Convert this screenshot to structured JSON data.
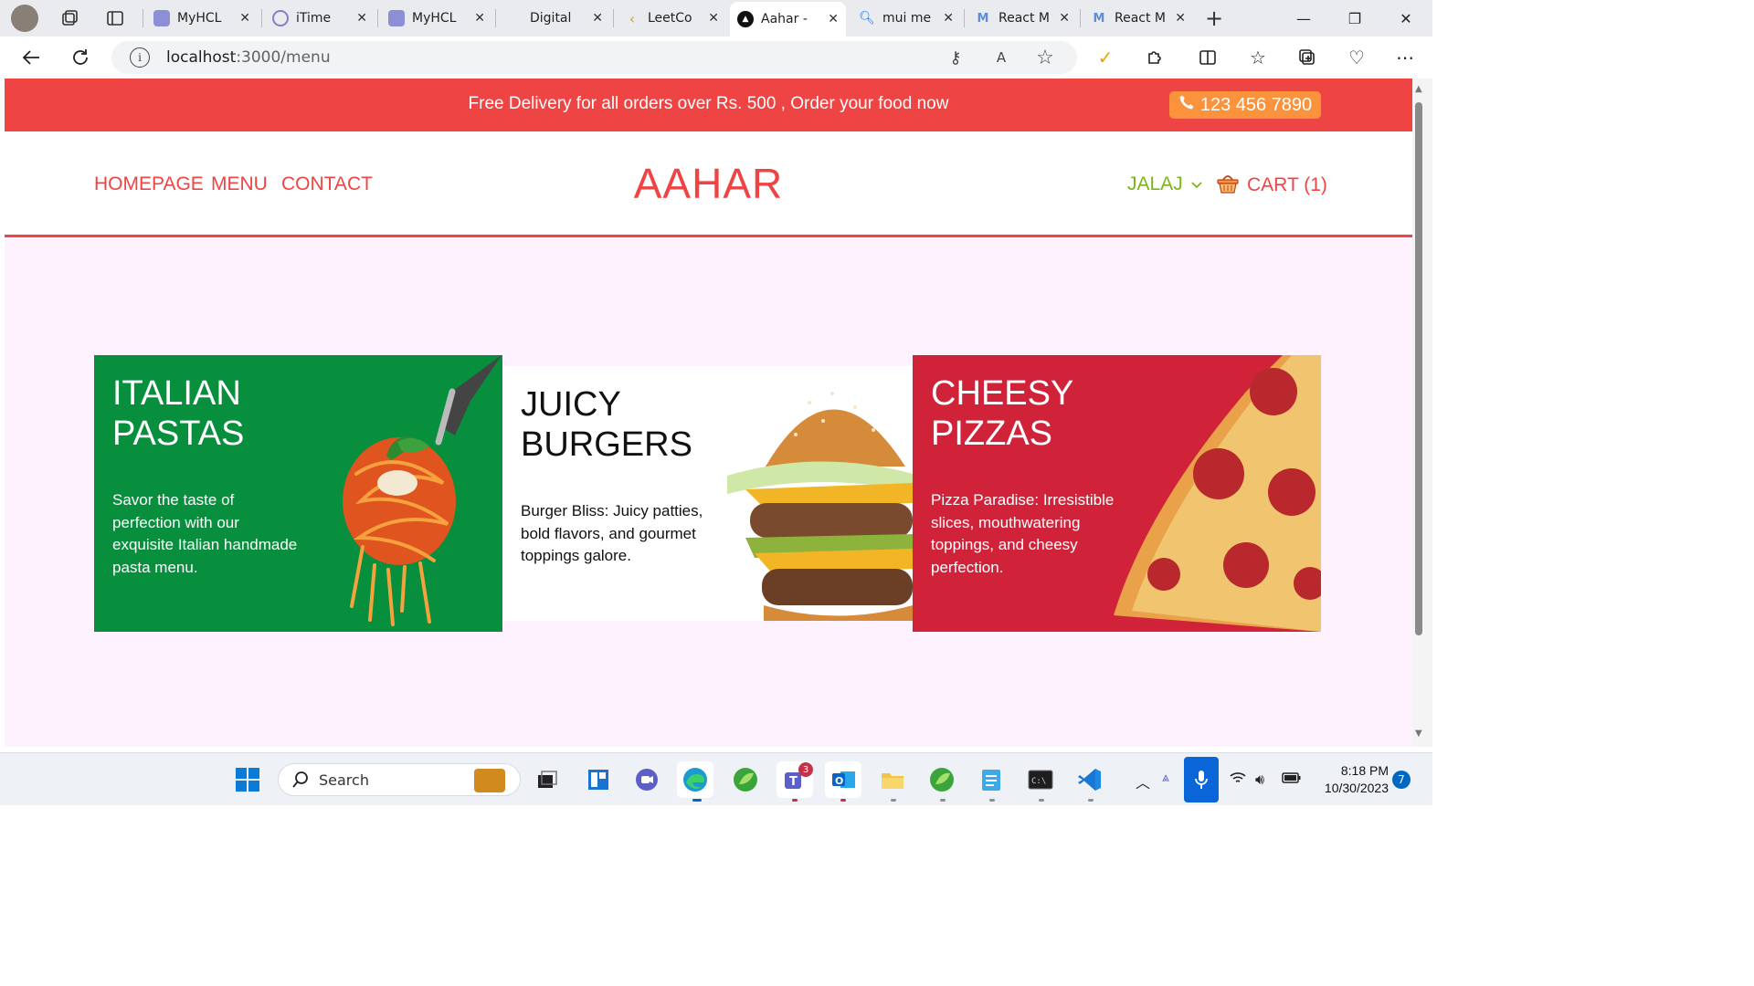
{
  "browser": {
    "tabs": [
      {
        "title": "MyHCL",
        "icon": "myhcl-favicon"
      },
      {
        "title": "iTime",
        "icon": "itime-favicon"
      },
      {
        "title": "MyHCL",
        "icon": "myhcl-favicon"
      },
      {
        "title": "Digital",
        "icon": "digital-favicon"
      },
      {
        "title": "LeetCo",
        "icon": "leetcode-favicon"
      },
      {
        "title": "Aahar -",
        "icon": "aahar-favicon",
        "active": true
      },
      {
        "title": "mui me",
        "icon": "search-favicon"
      },
      {
        "title": "React M",
        "icon": "mui-favicon"
      },
      {
        "title": "React M",
        "icon": "mui-favicon"
      }
    ],
    "address": {
      "host": "localhost",
      "path": ":3000/menu"
    }
  },
  "site": {
    "promo_text": "Free Delivery for all orders over Rs. 500 , Order your food now",
    "phone": "123 456 7890",
    "nav": {
      "home": "HOMEPAGE",
      "menu": "MENU",
      "contact": "CONTACT"
    },
    "logo": "AAHAR",
    "user": "JALAJ",
    "cart": "CART (1)",
    "colors": {
      "primary": "#ef4444",
      "promo_badge": "#fb923c",
      "user": "#7cb518",
      "page_bg": "#fdf2fd"
    }
  },
  "cards": [
    {
      "title_line1": "ITALIAN",
      "title_line2": "PASTAS",
      "text": "Savor the taste of perfection with our exquisite Italian handmade pasta menu.",
      "bg": "#078f3d",
      "fg": "#ffffff"
    },
    {
      "title_line1": "JUICY",
      "title_line2": "BURGERS",
      "text": "Burger Bliss: Juicy patties, bold flavors, and gourmet toppings galore.",
      "bg": "#ffffff",
      "fg": "#111111"
    },
    {
      "title_line1": "CHEESY",
      "title_line2": "PIZZAS",
      "text": "Pizza Paradise: Irresistible slices, mouthwatering toppings, and cheesy perfection.",
      "bg": "#d0233a",
      "fg": "#ffffff"
    }
  ],
  "taskbar": {
    "search_label": "Search",
    "time": "8:18 PM",
    "date": "10/30/2023",
    "notifications": "7",
    "teams_badge": "3"
  }
}
